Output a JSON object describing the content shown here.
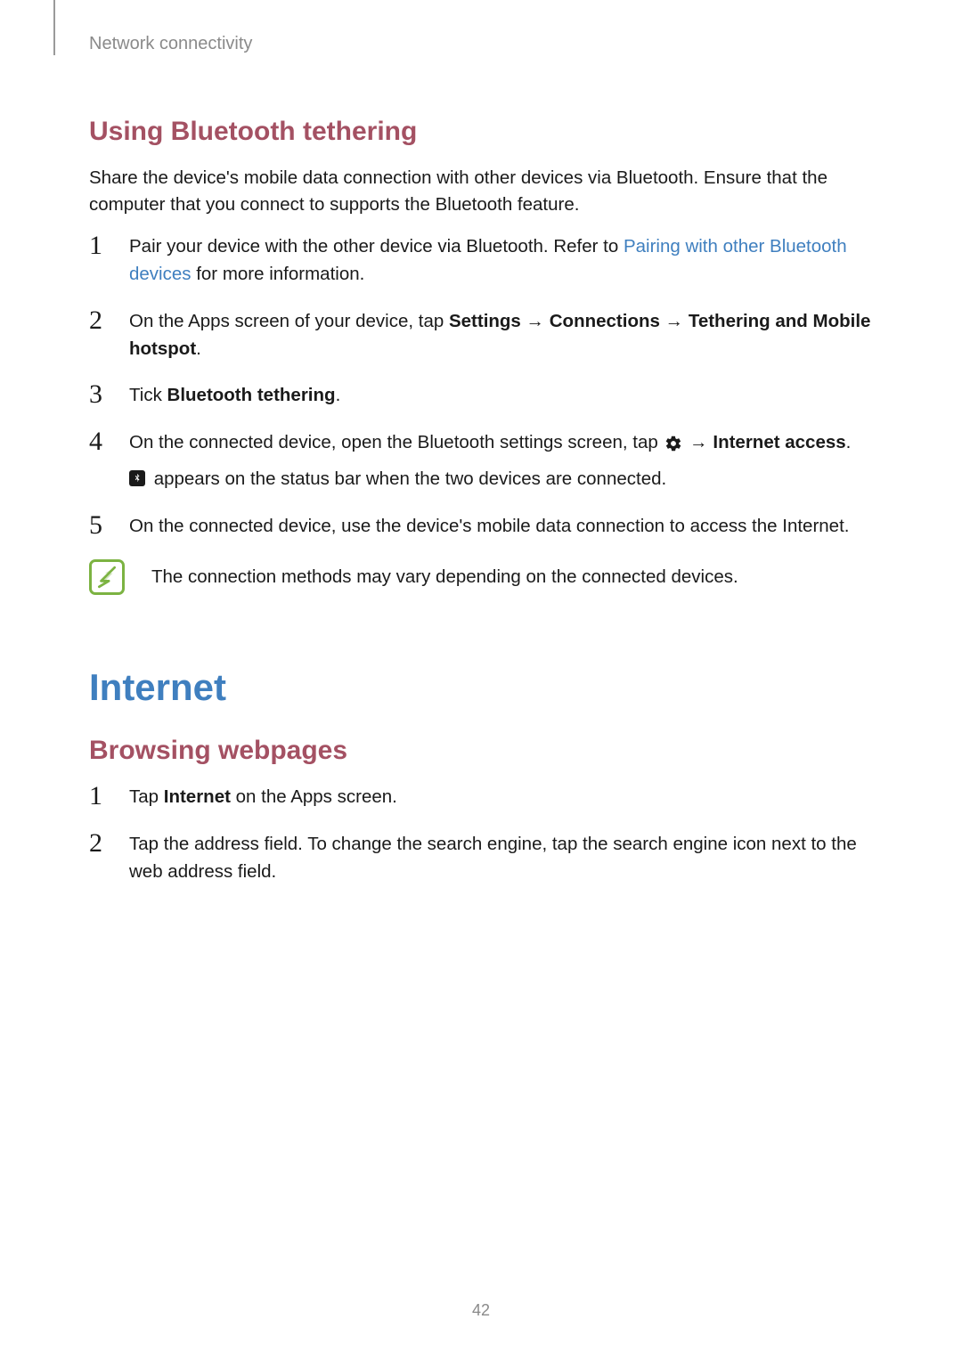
{
  "header": {
    "breadcrumb": "Network connectivity"
  },
  "section1": {
    "heading": "Using Bluetooth tethering",
    "intro": "Share the device's mobile data connection with other devices via Bluetooth. Ensure that the computer that you connect to supports the Bluetooth feature.",
    "steps": {
      "s1": {
        "num": "1",
        "text_a": "Pair your device with the other device via Bluetooth. Refer to ",
        "link": "Pairing with other Bluetooth devices",
        "text_b": " for more information."
      },
      "s2": {
        "num": "2",
        "text_a": "On the Apps screen of your device, tap ",
        "b1": "Settings",
        "arr1": " → ",
        "b2": "Connections",
        "arr2": " → ",
        "b3": "Tethering and Mobile hotspot",
        "dot": "."
      },
      "s3": {
        "num": "3",
        "text_a": "Tick ",
        "b1": "Bluetooth tethering",
        "dot": "."
      },
      "s4": {
        "num": "4",
        "text_a": "On the connected device, open the Bluetooth settings screen, tap ",
        "arr": " → ",
        "b1": "Internet access",
        "dot": ".",
        "sub": " appears on the status bar when the two devices are connected."
      },
      "s5": {
        "num": "5",
        "text": "On the connected device, use the device's mobile data connection to access the Internet."
      }
    },
    "note": "The connection methods may vary depending on the connected devices."
  },
  "section2": {
    "heading": "Internet",
    "sub_heading": "Browsing webpages",
    "steps": {
      "s1": {
        "num": "1",
        "text_a": "Tap ",
        "b1": "Internet",
        "text_b": " on the Apps screen."
      },
      "s2": {
        "num": "2",
        "text": "Tap the address field. To change the search engine, tap the search engine icon next to the web address field."
      }
    }
  },
  "page_number": "42"
}
